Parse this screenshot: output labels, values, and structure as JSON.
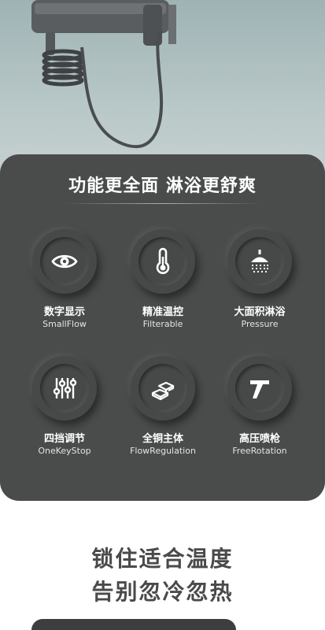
{
  "panel": {
    "title": "功能更全面 淋浴更舒爽"
  },
  "features": [
    {
      "cn": "数字显示",
      "en": "SmallFlow",
      "icon": "eye-icon"
    },
    {
      "cn": "精准温控",
      "en": "Filterable",
      "icon": "thermometer-icon"
    },
    {
      "cn": "大面积淋浴",
      "en": "Pressure",
      "icon": "shower-head-icon"
    },
    {
      "cn": "四挡调节",
      "en": "OneKeyStop",
      "icon": "sliders-icon"
    },
    {
      "cn": "全铜主体",
      "en": "FlowRegulation",
      "icon": "copper-bars-icon"
    },
    {
      "cn": "高压喷枪",
      "en": "FreeRotation",
      "icon": "spray-gun-icon"
    }
  ],
  "bottom": {
    "line1": "锁住适合温度",
    "line2": "告别忽冷忽热"
  },
  "colors": {
    "panel": "#4a4b4b",
    "hero_bg": "#aebfc0",
    "heading_dark": "#4a4a4a"
  }
}
